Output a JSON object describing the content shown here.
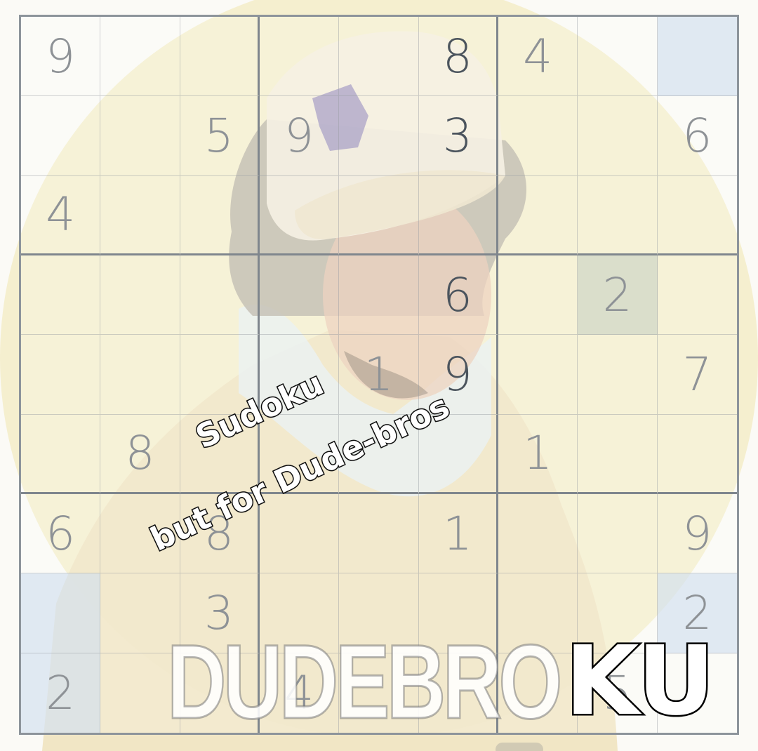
{
  "caption": {
    "line1": "Sudoku",
    "line2": "but for Dude-bros"
  },
  "logo": {
    "part1": "DUDEBRO",
    "part2": "KU"
  },
  "colors": {
    "digit": "#8e9296",
    "digit_dark": "#4b545d",
    "grid_line": "#8d949b",
    "highlight_blue": "#d6e2f0",
    "highlight_gray": "#c8d2c8",
    "background_circle": "#f3ecc8"
  },
  "board": {
    "rows": [
      [
        "9",
        "",
        "",
        "",
        "",
        "8",
        "4",
        "",
        ""
      ],
      [
        "",
        "",
        "5",
        "9",
        "",
        "3",
        "",
        "",
        "6"
      ],
      [
        "4",
        "",
        "",
        "",
        "",
        "",
        "",
        "",
        ""
      ],
      [
        "",
        "",
        "",
        "",
        "",
        "6",
        "",
        "2",
        ""
      ],
      [
        "",
        "",
        "",
        "",
        "1",
        "9",
        "",
        "",
        "7"
      ],
      [
        "",
        "8",
        "",
        "",
        "",
        "",
        "1",
        "",
        ""
      ],
      [
        "6",
        "",
        "8",
        "",
        "",
        "1",
        "",
        "",
        "9"
      ],
      [
        "",
        "",
        "3",
        "",
        "",
        "",
        "",
        "",
        "2"
      ],
      [
        "2",
        "",
        "",
        "4",
        "",
        "",
        "",
        "5",
        ""
      ]
    ],
    "dark_cells": [
      "0-5",
      "1-5",
      "3-5",
      "4-5"
    ],
    "highlighted_blue": [
      "0-8",
      "7-0",
      "7-8",
      "8-0"
    ],
    "highlighted_gray": [
      "3-7"
    ]
  }
}
